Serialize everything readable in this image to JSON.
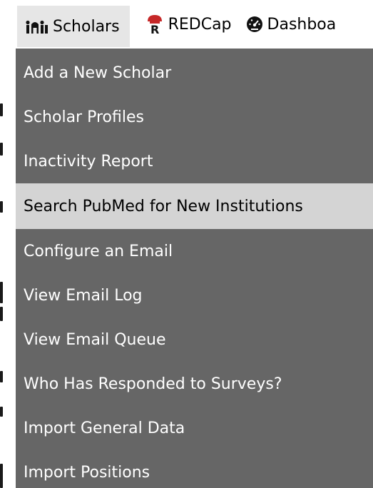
{
  "nav": {
    "items": [
      {
        "label": "Scholars",
        "icon": "people-icon",
        "active": true
      },
      {
        "label": "REDCap",
        "icon": "redcap-icon",
        "active": false
      },
      {
        "label": "Dashboa",
        "icon": "dashboard-gauge-icon",
        "active": false
      }
    ]
  },
  "menu": {
    "items": [
      {
        "label": "Add a New Scholar"
      },
      {
        "label": "Scholar Profiles"
      },
      {
        "label": "Inactivity Report"
      },
      {
        "label": "Search PubMed for New Institutions",
        "highlighted": true
      },
      {
        "label": "Configure an Email"
      },
      {
        "label": "View Email Log"
      },
      {
        "label": "View Email Queue"
      },
      {
        "label": "Who Has Responded to Surveys?"
      },
      {
        "label": "Import General Data"
      },
      {
        "label": "Import Positions"
      }
    ]
  },
  "colors": {
    "menu_bg": "#666666",
    "menu_highlight": "#d4d4d4",
    "active_tab_bg": "#e6e6e6",
    "redcap_red": "#c62828"
  }
}
